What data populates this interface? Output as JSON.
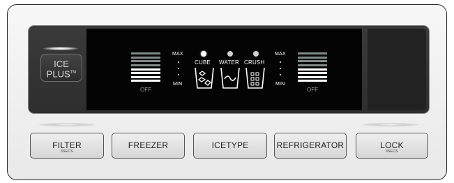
{
  "colors": {
    "bar_on": "#ffffff",
    "bar_off": "#7f8a88",
    "display_bg": "#040404",
    "panel_bg": "#ececec"
  },
  "ice_plus": {
    "line1": "ICE",
    "line2": "PLUS",
    "tm": "TM"
  },
  "freezer_temp": {
    "max_label": "MAX",
    "min_label": "MIN",
    "off_label": "OFF",
    "level": 4,
    "bar_count": 8
  },
  "fridge_temp": {
    "max_label": "MAX",
    "min_label": "MIN",
    "off_label": "OFF",
    "level": 4,
    "bar_count": 8
  },
  "ice_type": {
    "options": [
      {
        "label": "CUBE",
        "icon": "cube-icon",
        "selected": true
      },
      {
        "label": "WATER",
        "icon": "water-icon",
        "selected": false
      },
      {
        "label": "CRUSH",
        "icon": "crush-icon",
        "selected": false
      }
    ]
  },
  "buttons": {
    "filter": {
      "label": "FILTER",
      "sub": "3SECS"
    },
    "freezer": {
      "label": "FREEZER"
    },
    "ice_type": {
      "label": "ICETYPE"
    },
    "refrigerator": {
      "label": "REFRIGERATOR"
    },
    "lock": {
      "label": "LOCK",
      "sub": "3SECS"
    }
  }
}
